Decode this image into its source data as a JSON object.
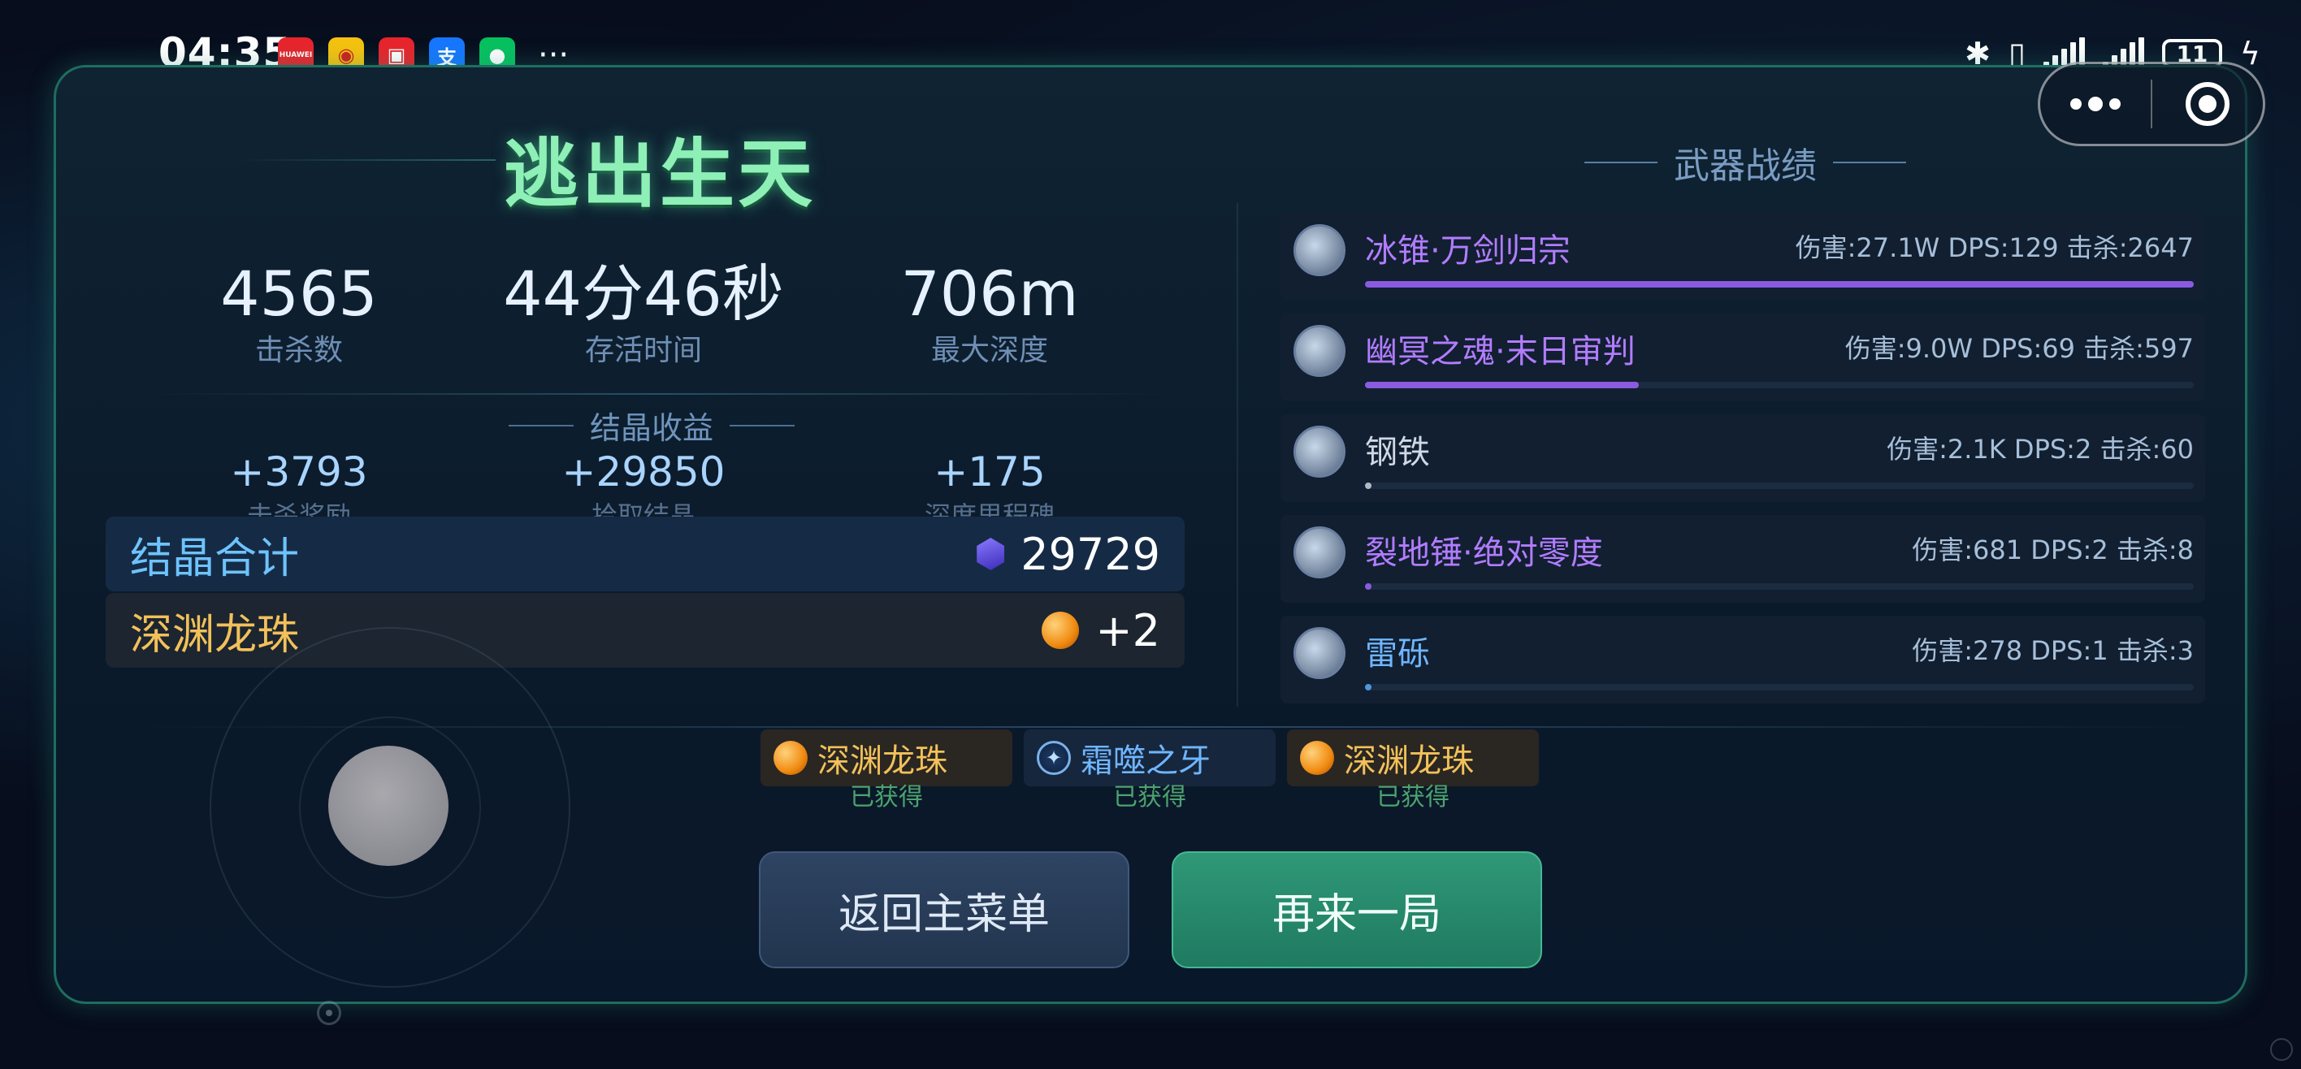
{
  "status_bar": {
    "time": "04:35",
    "apps": [
      {
        "name": "huawei-icon",
        "label": "HUAWEI",
        "color": "#e8242c"
      },
      {
        "name": "weibo-icon",
        "label": "微",
        "color": "#f5c20f"
      },
      {
        "name": "news-icon",
        "label": "新",
        "color": "#e8242c"
      },
      {
        "name": "alipay-icon",
        "label": "支",
        "color": "#1677ff"
      },
      {
        "name": "wechat-icon",
        "label": "微",
        "color": "#07c160"
      }
    ],
    "more": "···",
    "battery": "11"
  },
  "title": "逃出生天",
  "stats": [
    {
      "value": "4565",
      "label": "击杀数"
    },
    {
      "value": "44分46秒",
      "label": "存活时间"
    },
    {
      "value": "706m",
      "label": "最大深度"
    }
  ],
  "crystal_section": {
    "heading": "结晶收益",
    "items": [
      {
        "value": "+3793",
        "label": "击杀奖励"
      },
      {
        "value": "+29850",
        "label": "拾取结晶"
      },
      {
        "value": "+175",
        "label": "深度里程碑"
      }
    ]
  },
  "totals": {
    "crystal": {
      "label": "结晶合计",
      "value": "29729",
      "color": "#6ec3ff"
    },
    "orb": {
      "label": "深渊龙珠",
      "value": "+2",
      "color": "#f2c15a"
    }
  },
  "weapons": {
    "heading": "武器战绩",
    "items": [
      {
        "name": "冰锥·万剑归宗",
        "stats": "伤害:27.1W DPS:129 击杀:2647",
        "color": "#b27cff",
        "bar": 1.0,
        "bar_color": "#8a5be0"
      },
      {
        "name": "幽冥之魂·末日审判",
        "stats": "伤害:9.0W DPS:69 击杀:597",
        "color": "#b27cff",
        "bar": 0.33,
        "bar_color": "#8a5be0"
      },
      {
        "name": "钢铁",
        "stats": "伤害:2.1K DPS:2 击杀:60",
        "color": "#cfd8e4",
        "bar": 0.008,
        "bar_color": "#aeb9c6"
      },
      {
        "name": "裂地锤·绝对零度",
        "stats": "伤害:681 DPS:2 击杀:8",
        "color": "#b27cff",
        "bar": 0.005,
        "bar_color": "#8a5be0"
      },
      {
        "name": "雷砾",
        "stats": "伤害:278 DPS:1 击杀:3",
        "color": "#6fb6ff",
        "bar": 0.004,
        "bar_color": "#4f95e0"
      }
    ]
  },
  "rewards": [
    {
      "name": "深渊龙珠",
      "status": "已获得",
      "color": "#f2c15a",
      "icon": "orb-icon"
    },
    {
      "name": "霜噬之牙",
      "status": "已获得",
      "color": "#6fb6ff",
      "icon": "frost-fang-icon"
    },
    {
      "name": "深渊龙珠",
      "status": "已获得",
      "color": "#f2c15a",
      "icon": "orb-icon"
    }
  ],
  "buttons": {
    "menu": "返回主菜单",
    "again": "再来一局"
  }
}
